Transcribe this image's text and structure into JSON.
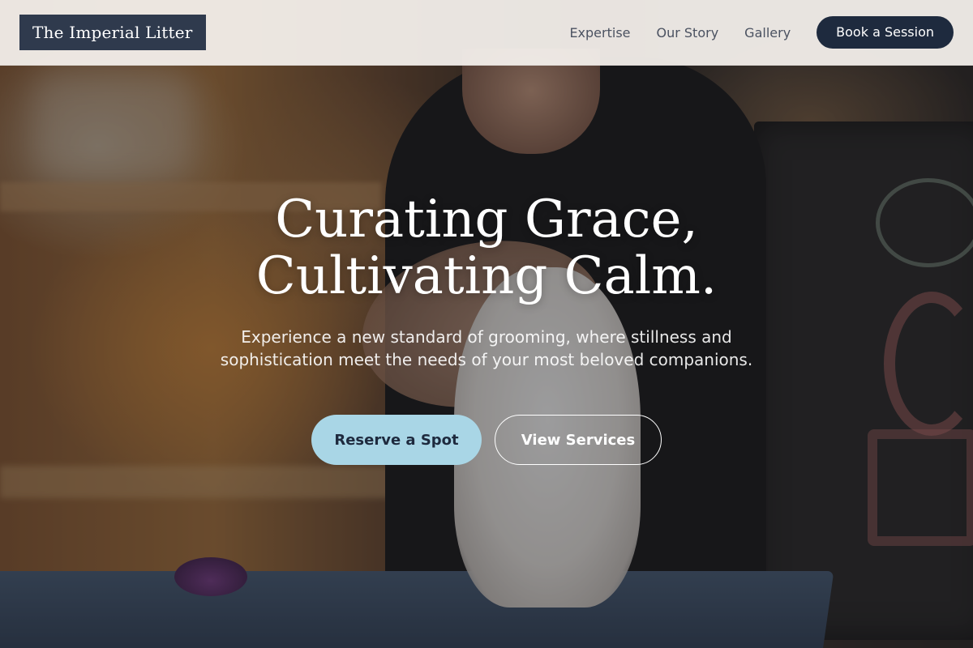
{
  "brand": {
    "name": "The Imperial Litter"
  },
  "nav": {
    "links": [
      "Expertise",
      "Our Story",
      "Gallery"
    ],
    "cta_label": "Book a Session"
  },
  "hero": {
    "headline_lines": [
      "Curating Grace,",
      "Cultivating Calm."
    ],
    "subtitle_lines": [
      "Experience a new standard of grooming, where stillness and",
      "sophistication meet the needs of your most beloved companions."
    ],
    "primary_cta": "Reserve a Spot",
    "secondary_cta": "View Services",
    "background_image": "grooming-photo"
  },
  "colors": {
    "brand_navy": "#1e2a3e",
    "logo_bg": "#2f3a4d",
    "accent_light_blue": "#a9d6e6",
    "header_bg": "#f4f0ec"
  }
}
